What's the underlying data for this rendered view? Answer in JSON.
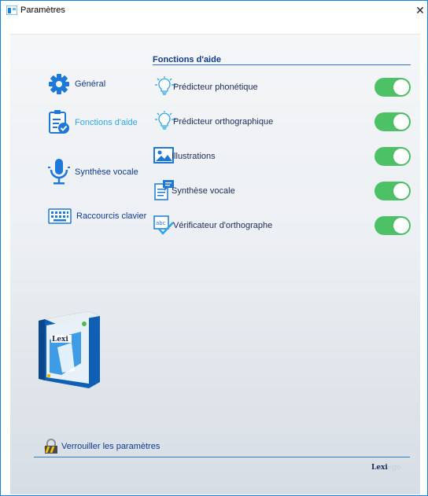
{
  "window": {
    "title": "Paramètres",
    "close_symbol": "✕",
    "accent": "#1883d7"
  },
  "sidebar": {
    "items": [
      {
        "label": "Général",
        "icon": "gear-icon"
      },
      {
        "label": "Fonctions d'aide",
        "icon": "clipboard-check-icon",
        "active": true
      },
      {
        "label": "Synthèse vocale",
        "icon": "microphone-icon"
      },
      {
        "label": "Raccourcis clavier",
        "icon": "keyboard-icon"
      }
    ]
  },
  "main": {
    "section_title": "Fonctions d'aide",
    "options": [
      {
        "label": "Prédicteur phonétique",
        "icon": "lightbulb-icon",
        "enabled": true
      },
      {
        "label": "Prédicteur orthographique",
        "icon": "lightbulb-icon",
        "enabled": true
      },
      {
        "label": "Illustrations",
        "icon": "image-icon",
        "enabled": true
      },
      {
        "label": "Synthèse vocale",
        "icon": "speech-document-icon",
        "enabled": true
      },
      {
        "label": "Vérificateur d'orthographe",
        "icon": "spellcheck-icon",
        "enabled": true
      }
    ]
  },
  "footer": {
    "lock_label": "Verrouiller les paramètres",
    "logo_main": "Lexi",
    "logo_suffix": "ego"
  },
  "colors": {
    "toggle_on": "#4cc166",
    "link": "#103a8c",
    "active_link": "#2ba6e8"
  }
}
